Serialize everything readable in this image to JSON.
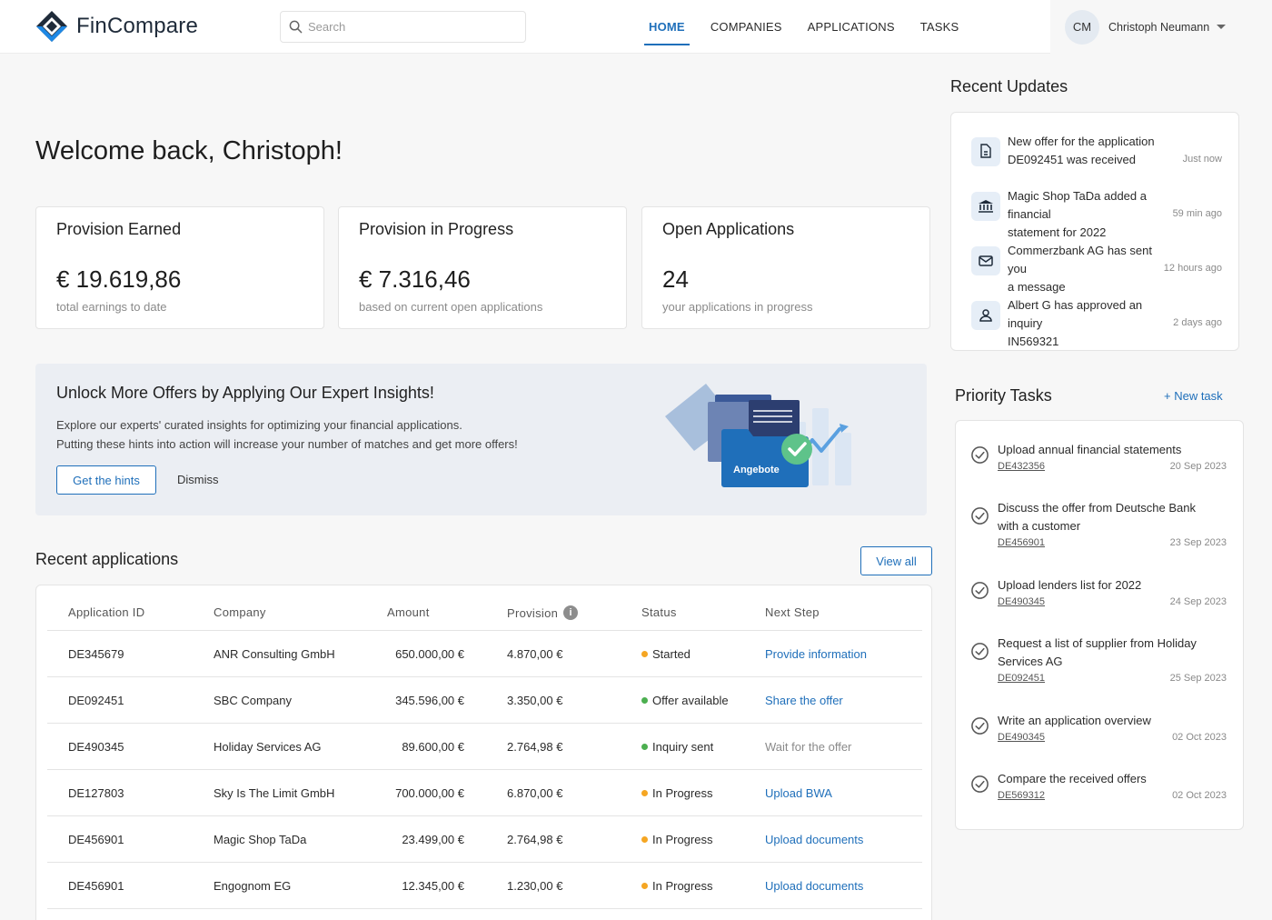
{
  "brand": {
    "name": "FinCompare"
  },
  "search": {
    "placeholder": "Search"
  },
  "nav": [
    {
      "label": "HOME",
      "active": true
    },
    {
      "label": "COMPANIES",
      "active": false
    },
    {
      "label": "APPLICATIONS",
      "active": false
    },
    {
      "label": "TASKS",
      "active": false
    }
  ],
  "user": {
    "initials": "CM",
    "name": "Christoph Neumann"
  },
  "welcome": "Welcome back, Christoph!",
  "kpis": [
    {
      "title": "Provision Earned",
      "value": "€ 19.619,86",
      "sub": "total earnings to date"
    },
    {
      "title": "Provision in Progress",
      "value": "€ 7.316,46",
      "sub": "based on current open applications"
    },
    {
      "title": "Open Applications",
      "value": "24",
      "sub": "your applications in progress"
    }
  ],
  "banner": {
    "title": "Unlock More Offers by Applying Our Expert Insights!",
    "line1": "Explore our experts' curated insights for optimizing your financial applications.",
    "line2": "Putting these hints into action will increase your number of matches and get more offers!",
    "cta": "Get the hints",
    "dismiss": "Dismiss",
    "art_label": "Angebote"
  },
  "recent_apps": {
    "title": "Recent applications",
    "view_all": "View all",
    "columns": [
      "Application ID",
      "Company",
      "Amount",
      "Provision",
      "Status",
      "Next Step"
    ],
    "rows": [
      {
        "id": "DE345679",
        "company": "ANR Consulting GmbH",
        "amount": "650.000,00 €",
        "provision": "4.870,00 €",
        "status": "Started",
        "status_color": "#f5a623",
        "next": "Provide information",
        "next_link": true
      },
      {
        "id": "DE092451",
        "company": "SBC Company",
        "amount": "345.596,00 €",
        "provision": "3.350,00 €",
        "status": "Offer available",
        "status_color": "#4caf50",
        "next": "Share the offer",
        "next_link": true
      },
      {
        "id": "DE490345",
        "company": "Holiday Services AG",
        "amount": "89.600,00 €",
        "provision": "2.764,98 €",
        "status": "Inquiry sent",
        "status_color": "#4caf50",
        "next": "Wait for the offer",
        "next_link": false
      },
      {
        "id": "DE127803",
        "company": "Sky Is The Limit GmbH",
        "amount": "700.000,00 €",
        "provision": "6.870,00 €",
        "status": "In Progress",
        "status_color": "#f5a623",
        "next": "Upload BWA",
        "next_link": true
      },
      {
        "id": "DE456901",
        "company": "Magic Shop TaDa",
        "amount": "23.499,00 €",
        "provision": "2.764,98 €",
        "status": "In Progress",
        "status_color": "#f5a623",
        "next": "Upload documents",
        "next_link": true
      },
      {
        "id": "DE456901",
        "company": "Engognom EG",
        "amount": "12.345,00 €",
        "provision": "1.230,00 €",
        "status": "In Progress",
        "status_color": "#f5a623",
        "next": "Upload documents",
        "next_link": true
      }
    ]
  },
  "updates": {
    "title": "Recent Updates",
    "items": [
      {
        "icon": "document-icon",
        "line1": "New offer for the application",
        "line2": "DE092451 was received",
        "time": "Just now"
      },
      {
        "icon": "bank-icon",
        "line1": "Magic Shop TaDa added a financial",
        "line2": "statement for 2022",
        "time": "59 min ago"
      },
      {
        "icon": "mail-icon",
        "line1": "Commerzbank AG has sent you",
        "line2": "a message",
        "time": "12 hours ago"
      },
      {
        "icon": "user-icon",
        "line1": "Albert G has approved an inquiry",
        "line2": "IN569321",
        "time": "2 days ago"
      }
    ]
  },
  "tasks": {
    "title": "Priority Tasks",
    "new_task": "+ New task",
    "items": [
      {
        "line1": "Upload annual financial statements",
        "line2": "",
        "id": "DE432356",
        "date": "20 Sep 2023"
      },
      {
        "line1": "Discuss the offer from Deutsche Bank",
        "line2": "with a customer",
        "id": "DE456901",
        "date": "23 Sep 2023"
      },
      {
        "line1": "Upload lenders list for 2022",
        "line2": "",
        "id": "DE490345",
        "date": "24 Sep 2023"
      },
      {
        "line1": "Request a list of supplier from Holiday",
        "line2": "Services AG",
        "id": "DE092451",
        "date": "25 Sep 2023"
      },
      {
        "line1": "Write an application overview",
        "line2": "",
        "id": "DE490345",
        "date": "02 Oct 2023"
      },
      {
        "line1": "Compare the received offers",
        "line2": "",
        "id": "DE569312",
        "date": "02 Oct 2023"
      }
    ]
  }
}
